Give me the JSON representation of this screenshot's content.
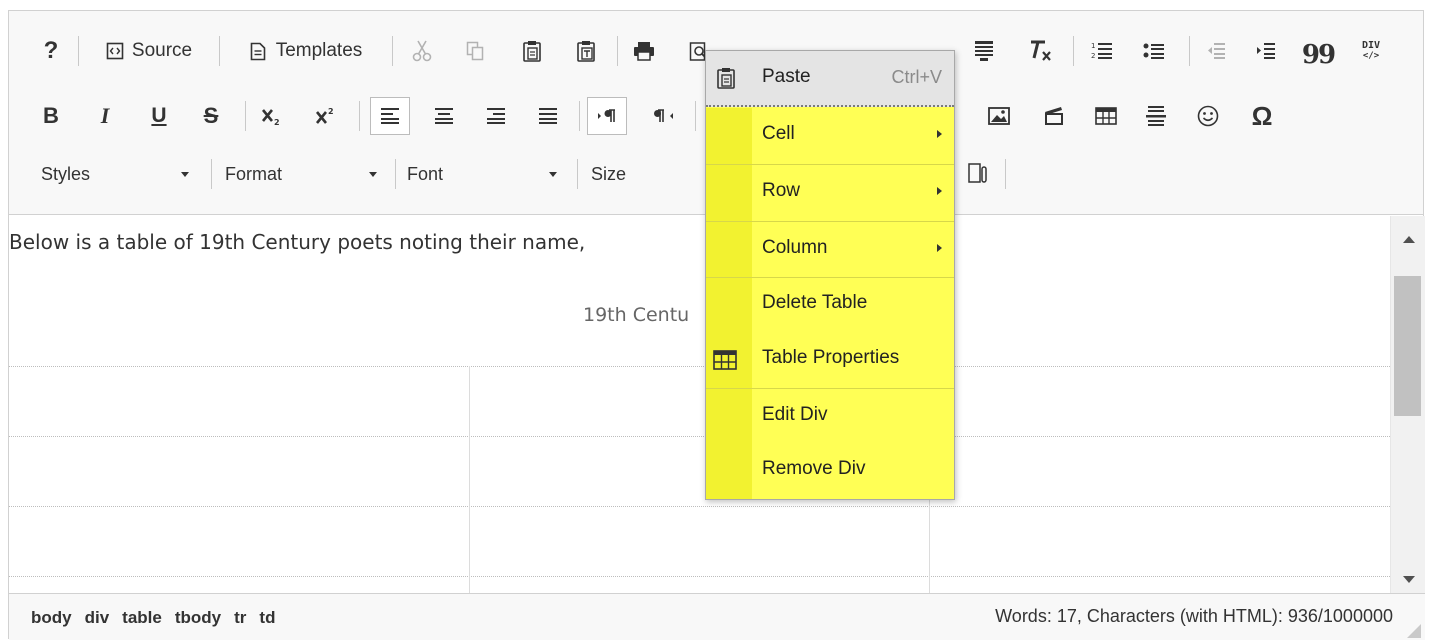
{
  "toolbar": {
    "help_label": "?",
    "source_label": "Source",
    "templates_label": "Templates",
    "bold_label": "B",
    "italic_label": "I",
    "underline_label": "U",
    "strike_label": "S",
    "blockquote_label": "99",
    "div_label": "DIV",
    "omega_label": "Ω",
    "styles_label": "Styles",
    "format_label": "Format",
    "font_label": "Font",
    "size_label": "Size",
    "icons": [
      "help-icon",
      "source-icon",
      "templates-icon",
      "cut-icon",
      "copy-icon",
      "paste-icon",
      "paste-text-icon",
      "print-icon",
      "find-icon",
      "undo-icon",
      "redo-icon",
      "replace-icon",
      "spellcheck-icon",
      "showblocks-icon",
      "remove-format-icon",
      "numbered-list-icon",
      "bulleted-list-icon",
      "outdent-icon",
      "indent-icon",
      "blockquote-icon",
      "create-div-icon",
      "image-icon",
      "flash-icon",
      "table-icon",
      "horizontal-rule-icon",
      "smiley-icon",
      "special-char-icon"
    ]
  },
  "content": {
    "intro_text": "Below is a table of 19th Century poets noting their name,",
    "caption_text": "19th Centu"
  },
  "context_menu": {
    "paste_label": "Paste",
    "paste_shortcut": "Ctrl+V",
    "items": [
      {
        "label": "Cell",
        "submenu": true
      },
      {
        "label": "Row",
        "submenu": true
      },
      {
        "label": "Column",
        "submenu": true
      },
      {
        "label": "Delete Table",
        "submenu": false
      },
      {
        "label": "Table Properties",
        "submenu": false
      },
      {
        "label": "Edit Div",
        "submenu": false
      },
      {
        "label": "Remove Div",
        "submenu": false
      }
    ],
    "highlight_color": "#ffff55"
  },
  "statusbar": {
    "path": [
      "body",
      "div",
      "table",
      "tbody",
      "tr",
      "td"
    ],
    "wordcount": "Words: 17, Characters (with HTML): 936/1000000"
  }
}
